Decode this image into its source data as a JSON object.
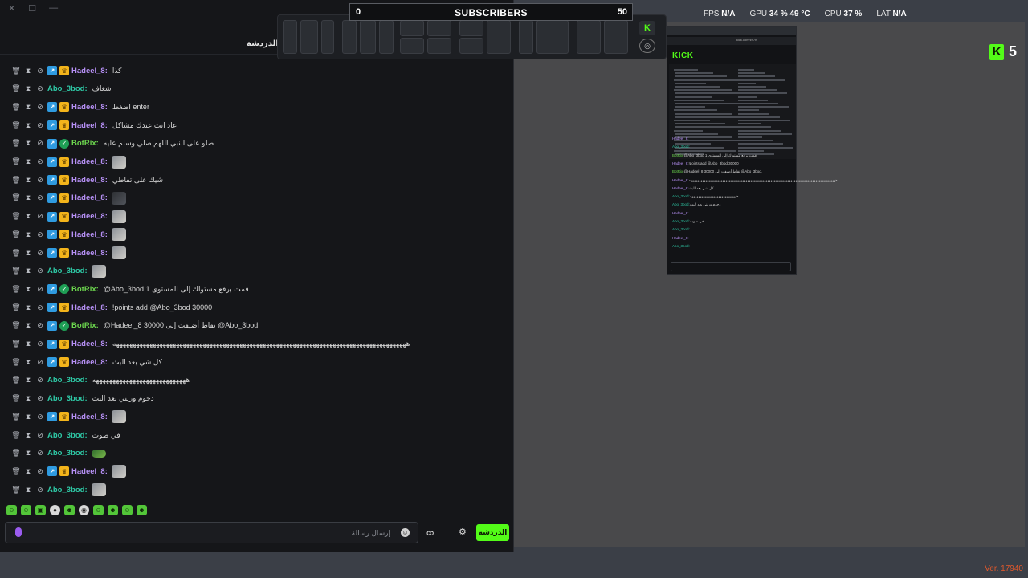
{
  "chat": {
    "title": "الدردشة",
    "messages": [
      {
        "user": "Hadeel_8:",
        "text": "كذا",
        "type": "hadeel",
        "emote": ""
      },
      {
        "user": "Abo_3bod:",
        "text": "شغاف",
        "type": "abo",
        "emote": ""
      },
      {
        "user": "Hadeel_8:",
        "text": "اضغط enter",
        "type": "hadeel",
        "emote": ""
      },
      {
        "user": "Hadeel_8:",
        "text": "عاد انت عندك مشاكل",
        "type": "hadeel",
        "emote": ""
      },
      {
        "user": "BotRix:",
        "text": "صلو على النبي اللهم صلي وسلم عليه",
        "type": "bot",
        "emote": ""
      },
      {
        "user": "Hadeel_8:",
        "text": "",
        "type": "hadeel",
        "emote": "face"
      },
      {
        "user": "Hadeel_8:",
        "text": "شيك على تفاطي",
        "type": "hadeel",
        "emote": ""
      },
      {
        "user": "Hadeel_8:",
        "text": "",
        "type": "hadeel",
        "emote": "dark"
      },
      {
        "user": "Hadeel_8:",
        "text": "",
        "type": "hadeel",
        "emote": "face"
      },
      {
        "user": "Hadeel_8:",
        "text": "",
        "type": "hadeel",
        "emote": "face"
      },
      {
        "user": "Hadeel_8:",
        "text": "",
        "type": "hadeel",
        "emote": "face"
      },
      {
        "user": "Abo_3bod:",
        "text": "",
        "type": "abo",
        "emote": "face"
      },
      {
        "user": "BotRix:",
        "text": "@Abo_3bod 1 قمت برفع مستواك إلى المستوى",
        "type": "bot",
        "emote": ""
      },
      {
        "user": "Hadeel_8:",
        "text": "!points add @Abo_3bod 30000",
        "type": "hadeel",
        "emote": ""
      },
      {
        "user": "BotRix:",
        "text": "@Hadeel_8 30000 نقاط أضيفت إلى @Abo_3bod.",
        "type": "bot",
        "emote": ""
      },
      {
        "user": "Hadeel_8:",
        "text": "ههههههههههههههههههههههههههههههههههههههههههههههههههههههههههههههههههههههههههههههههههههههههه",
        "type": "hadeel",
        "emote": ""
      },
      {
        "user": "Hadeel_8:",
        "text": "كل شي بعد البث",
        "type": "hadeel",
        "emote": ""
      },
      {
        "user": "Abo_3bod:",
        "text": "ههههههههههههههههههههههههههههه",
        "type": "abo",
        "emote": ""
      },
      {
        "user": "Abo_3bod:",
        "text": "دحوم وريني بعد البث",
        "type": "abo",
        "emote": ""
      },
      {
        "user": "Hadeel_8:",
        "text": "",
        "type": "hadeel",
        "emote": "face"
      },
      {
        "user": "Abo_3bod:",
        "text": "في صوت",
        "type": "abo",
        "emote": ""
      },
      {
        "user": "Abo_3bod:",
        "text": "",
        "type": "abo",
        "emote": "frog"
      },
      {
        "user": "Hadeel_8:",
        "text": "",
        "type": "hadeel",
        "emote": "face"
      },
      {
        "user": "Abo_3bod:",
        "text": "",
        "type": "abo",
        "emote": "face"
      }
    ],
    "input_placeholder": "إرسال رسالة",
    "send_button": "الدردشة"
  },
  "overlay": {
    "subs_title": "SUBSCRIBERS",
    "subs_min": "0",
    "subs_max": "50",
    "url": "kick.com/popout/zn7n/chat"
  },
  "stats": {
    "fps_label": "FPS",
    "fps_value": "N/A",
    "gpu_label": "GPU",
    "gpu_value": "34 % 49 °C",
    "cpu_label": "CPU",
    "cpu_value": "37 %",
    "lat_label": "LAT",
    "lat_value": "N/A"
  },
  "kick_counter": {
    "logo": "K",
    "count": "5"
  },
  "preview": {
    "logo": "KICK",
    "url": "kick.com/zn7n"
  },
  "version": "Ver. 17940",
  "colors": {
    "kick_green": "#53fc18",
    "hadeel_name": "#b690f5",
    "abo_name": "#2ec9a6",
    "bot_name": "#6cd64e",
    "version_orange": "#e0582c"
  }
}
